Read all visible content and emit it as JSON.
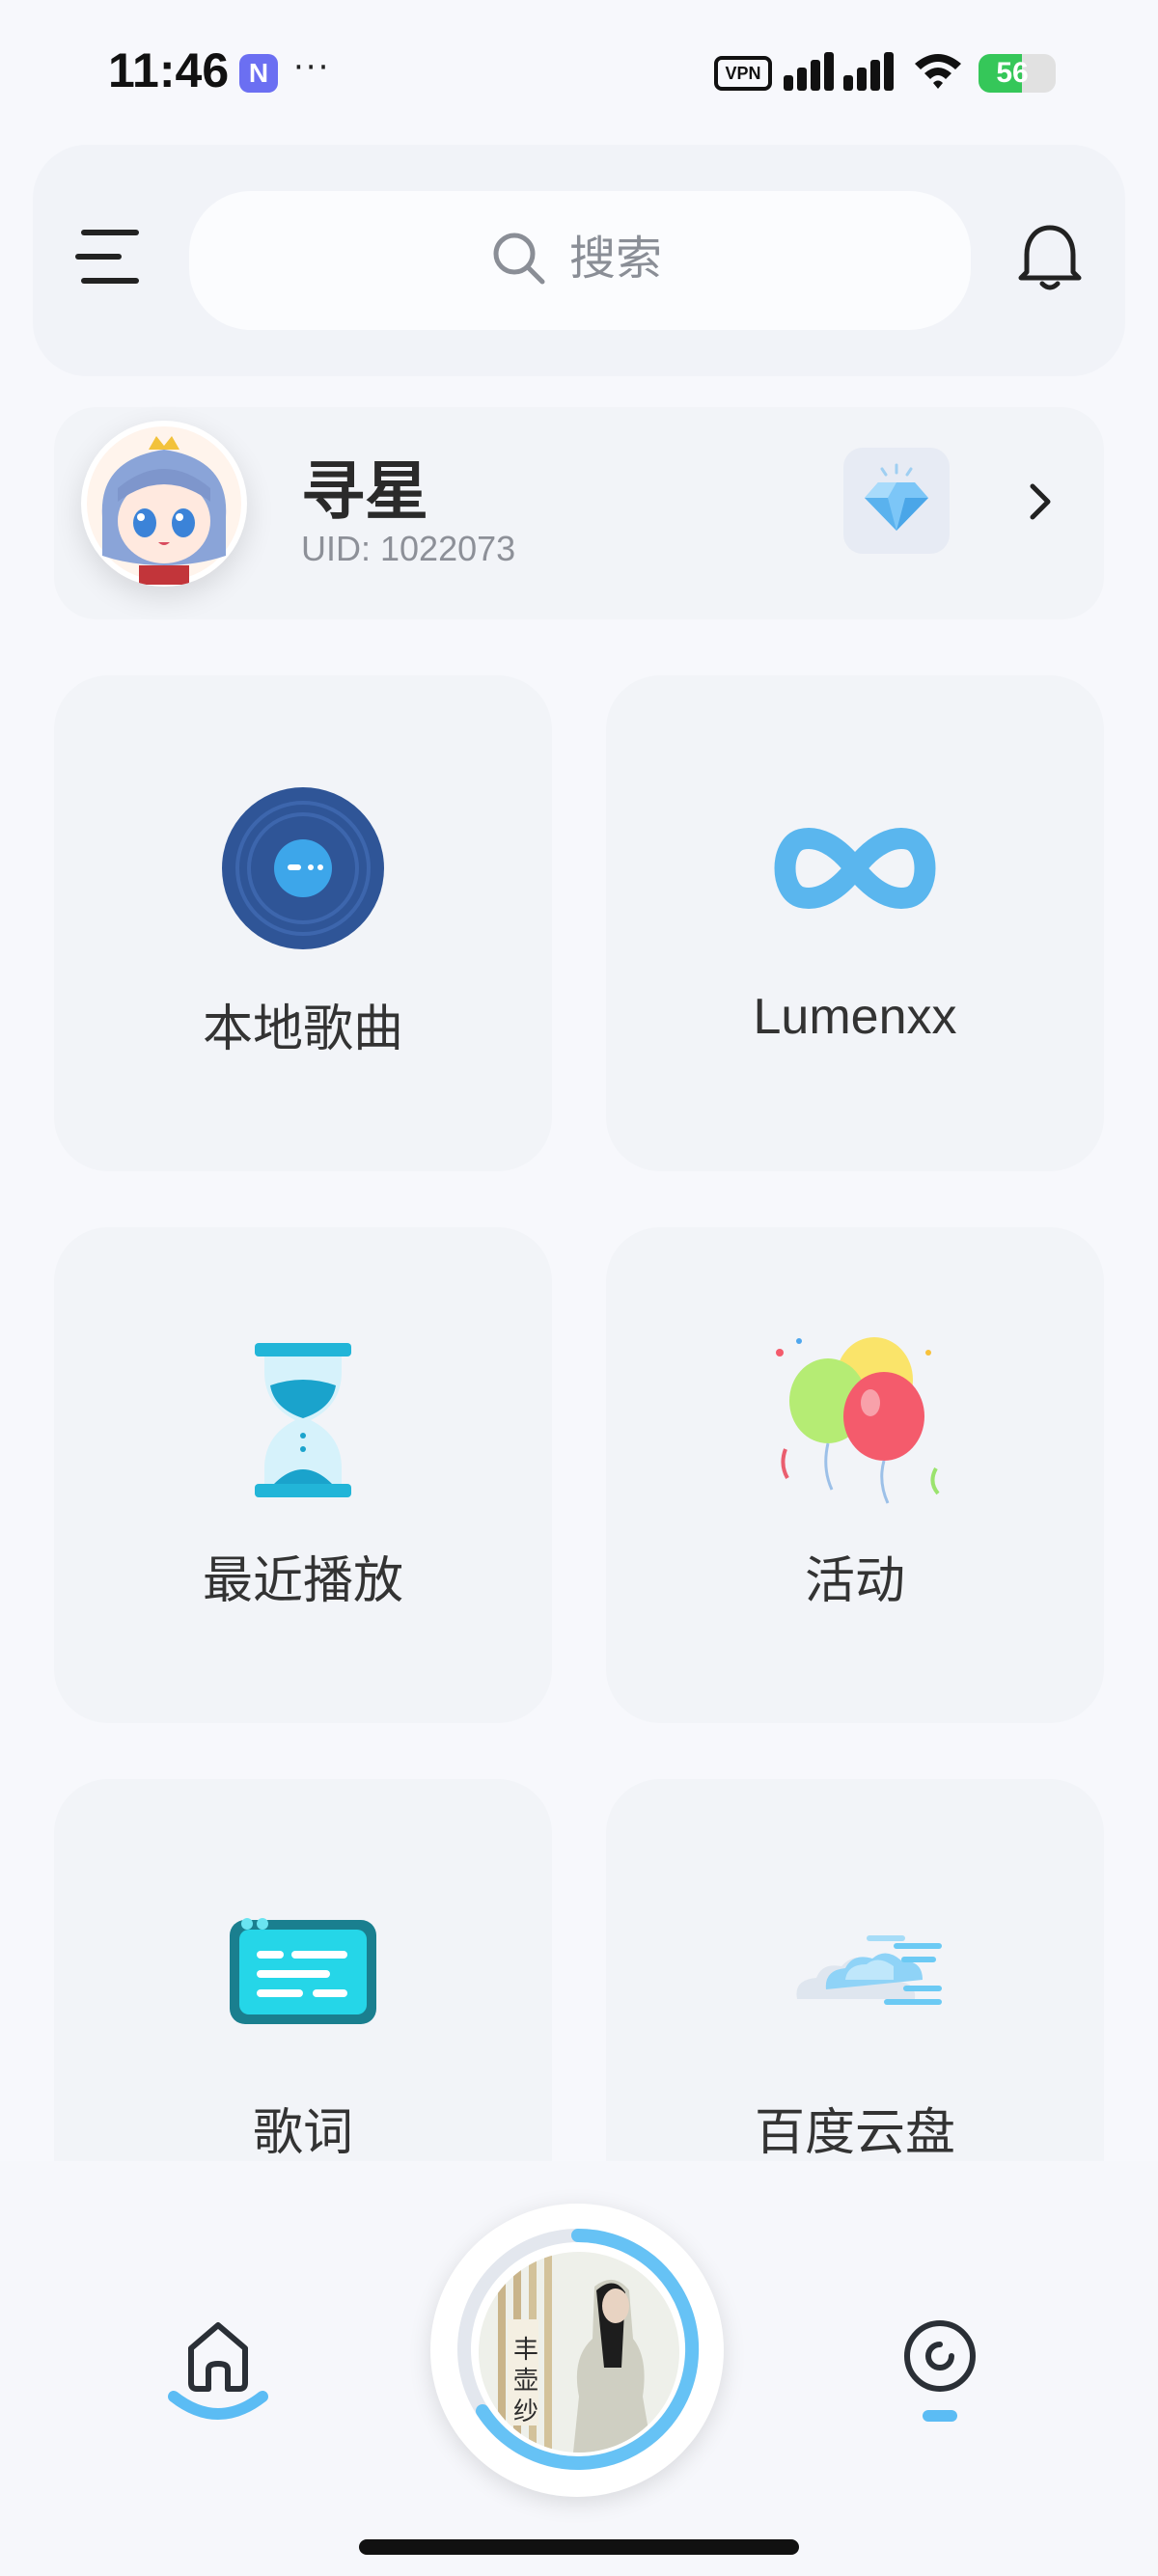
{
  "status_bar": {
    "time": "11:46",
    "notification_app_letter": "N",
    "more_indicator": "···",
    "vpn_label": "VPN",
    "battery_level": "56",
    "battery_fraction": 0.56,
    "icons": [
      "signal-icon",
      "wifi-icon",
      "battery-icon"
    ]
  },
  "header": {
    "menu_icon": "menu-icon",
    "search_placeholder": "搜索",
    "search_icon": "search-icon",
    "notification_icon": "bell-icon"
  },
  "profile": {
    "name": "寻星",
    "uid": "UID: 1022073",
    "vip_icon": "diamond-icon",
    "chevron_icon": "chevron-right-icon"
  },
  "tiles": [
    {
      "label": "本地歌曲",
      "icon": "vinyl-record-icon"
    },
    {
      "label": "Lumenxx",
      "icon": "infinity-icon"
    },
    {
      "label": "最近播放",
      "icon": "hourglass-icon"
    },
    {
      "label": "活动",
      "icon": "balloons-icon"
    },
    {
      "label": "歌词",
      "icon": "lyrics-card-icon"
    },
    {
      "label": "百度云盘",
      "icon": "cloud-icon"
    }
  ],
  "bottom_nav": {
    "home_icon": "home-icon",
    "now_playing_icon": "album-art",
    "discover_icon": "disc-icon"
  },
  "colors": {
    "accent": "#4fb5f5",
    "background": "#f7f8fc",
    "battery_green": "#35c759"
  }
}
